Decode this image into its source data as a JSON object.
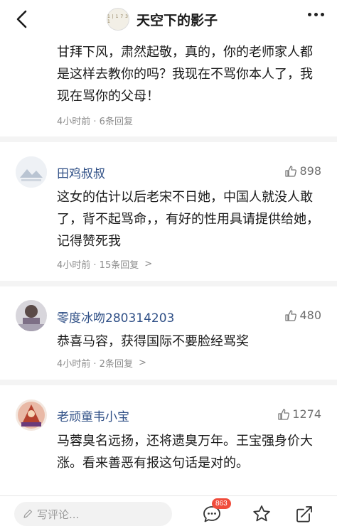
{
  "header": {
    "title": "天空下的影子",
    "avatar_text": "1 | 1 7 3 1"
  },
  "comments": [
    {
      "body": "甘拜下风，肃然起敬，真的，你的老师家人都是这样去教你的吗？我现在不骂你本人了，我现在骂你的父母！",
      "meta": "4小时前 · 6条回复"
    },
    {
      "username": "田鸡叔叔",
      "likes": "898",
      "body": "这女的估计以后老宋不日她，中国人就没人敢了，背不起骂命，，有好的性用具请提供给她，记得赞死我",
      "meta": "4小时前 · 15条回复"
    },
    {
      "username": "零度冰吻280314203",
      "likes": "480",
      "body": "恭喜马容，获得国际不要脸经骂奖",
      "meta": "4小时前 · 2条回复"
    },
    {
      "username": "老顽童韦小宝",
      "likes": "1274",
      "body": "马蓉臭名远扬，还将遗臭万年。王宝强身价大涨。看来善恶有报这句话是对的。"
    }
  ],
  "bottom_bar": {
    "placeholder": "写评论...",
    "comment_count": "863"
  },
  "icons": {
    "back": "back-arrow-icon",
    "more": "more-dots-icon",
    "like": "thumbs-up-icon",
    "comment": "comment-bubble-icon",
    "favorite": "star-icon",
    "share": "share-icon",
    "pen": "pen-icon"
  },
  "colors": {
    "username": "#2f4f86",
    "meta": "#8c8c8c",
    "badge": "#f04c3c"
  }
}
